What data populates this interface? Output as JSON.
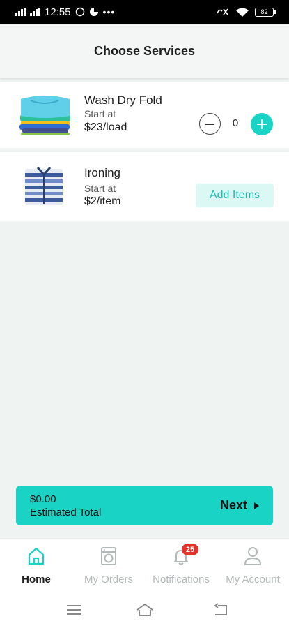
{
  "status_bar": {
    "time": "12:55",
    "battery": "82"
  },
  "header": {
    "title": "Choose Services"
  },
  "services": [
    {
      "name": "Wash Dry Fold",
      "start_label": "Start at",
      "price": "$23/load",
      "quantity": "0",
      "icon": "folded-clothes-icon"
    },
    {
      "name": "Ironing",
      "start_label": "Start at",
      "price": "$2/item",
      "action_label": "Add Items",
      "icon": "shirt-icon"
    }
  ],
  "total": {
    "amount": "$0.00",
    "label": "Estimated Total",
    "next_label": "Next"
  },
  "tabs": [
    {
      "label": "Home",
      "icon": "home-icon",
      "active": true
    },
    {
      "label": "My Orders",
      "icon": "washing-machine-icon",
      "active": false
    },
    {
      "label": "Notifications",
      "icon": "bell-icon",
      "active": false,
      "badge": "25"
    },
    {
      "label": "My Account",
      "icon": "user-icon",
      "active": false
    }
  ],
  "colors": {
    "accent": "#19d3c5",
    "accent_light": "#dcf8f5",
    "badge": "#e5322d",
    "background": "#eff3f2"
  }
}
